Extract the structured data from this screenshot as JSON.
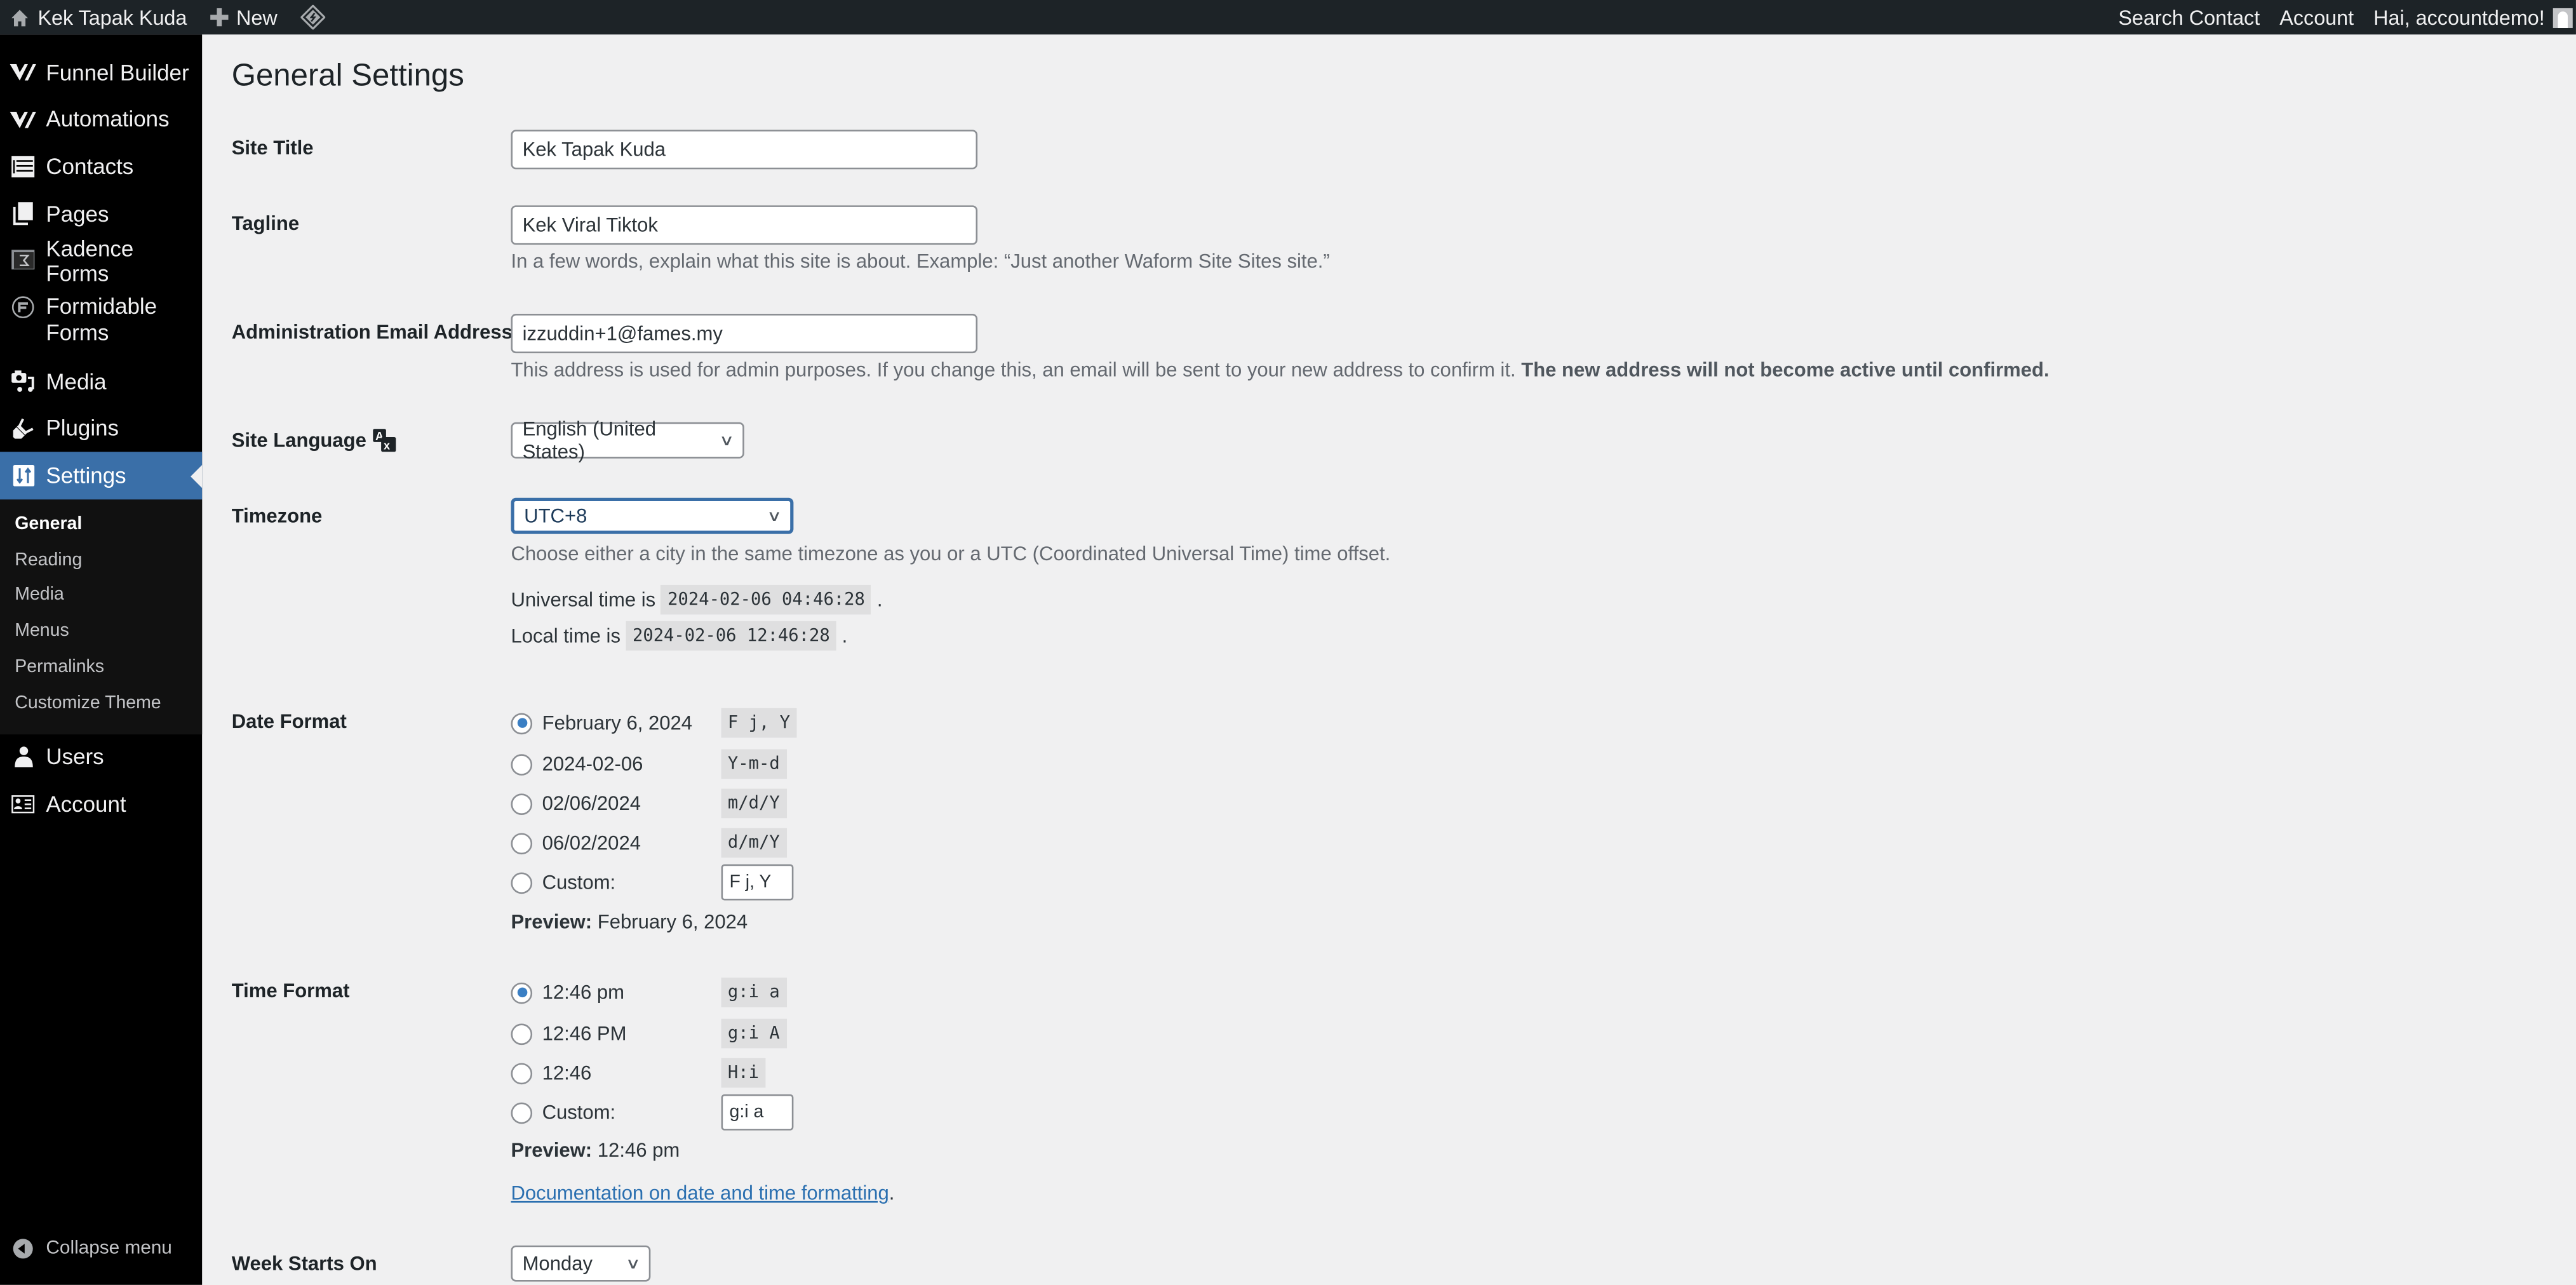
{
  "adminbar": {
    "site_name": "Kek Tapak Kuda",
    "new_label": "New",
    "search_contact": "Search Contact",
    "account": "Account",
    "greeting": "Hai, accountdemo!"
  },
  "sidebar": {
    "items": [
      {
        "label": "Funnel Builder",
        "icon": "funnel-builder-icon"
      },
      {
        "label": "Automations",
        "icon": "automations-icon"
      },
      {
        "label": "Contacts",
        "icon": "contacts-list-icon"
      },
      {
        "label": "Pages",
        "icon": "pages-icon"
      },
      {
        "label": "Kadence Forms",
        "icon": "kadence-forms-icon"
      },
      {
        "label": "Formidable Forms",
        "icon": "formidable-forms-icon"
      },
      {
        "label": "Media",
        "icon": "media-icon"
      },
      {
        "label": "Plugins",
        "icon": "plugins-icon"
      },
      {
        "label": "Settings",
        "icon": "settings-icon",
        "active": true
      }
    ],
    "submenu": [
      "General",
      "Reading",
      "Media",
      "Menus",
      "Permalinks",
      "Customize Theme"
    ],
    "items_after": [
      {
        "label": "Users",
        "icon": "users-icon"
      },
      {
        "label": "Account",
        "icon": "account-card-icon"
      }
    ],
    "collapse_label": "Collapse menu"
  },
  "page": {
    "title": "General Settings",
    "site_title": {
      "label": "Site Title",
      "value": "Kek Tapak Kuda"
    },
    "tagline": {
      "label": "Tagline",
      "value": "Kek Viral Tiktok",
      "description": "In a few words, explain what this site is about. Example: “Just another Waform Site Sites site.”"
    },
    "admin_email": {
      "label": "Administration Email Address",
      "value": "izzuddin+1@fames.my",
      "description": "This address is used for admin purposes. If you change this, an email will be sent to your new address to confirm it.",
      "description_bold": "The new address will not become active until confirmed."
    },
    "site_language": {
      "label": "Site Language",
      "value": "English (United States)"
    },
    "timezone": {
      "label": "Timezone",
      "value": "UTC+8",
      "description": "Choose either a city in the same timezone as you or a UTC (Coordinated Universal Time) time offset.",
      "universal_label": "Universal time is",
      "universal_value": "2024-02-06 04:46:28",
      "local_label": "Local time is",
      "local_value": "2024-02-06 12:46:28"
    },
    "date_format": {
      "label": "Date Format",
      "options": [
        {
          "text": "February 6, 2024",
          "code": "F j, Y",
          "checked": true
        },
        {
          "text": "2024-02-06",
          "code": "Y-m-d"
        },
        {
          "text": "02/06/2024",
          "code": "m/d/Y"
        },
        {
          "text": "06/02/2024",
          "code": "d/m/Y"
        }
      ],
      "custom_label": "Custom:",
      "custom_value": "F j, Y",
      "preview_label": "Preview:",
      "preview_value": "February 6, 2024"
    },
    "time_format": {
      "label": "Time Format",
      "options": [
        {
          "text": "12:46 pm",
          "code": "g:i a",
          "checked": true
        },
        {
          "text": "12:46 PM",
          "code": "g:i A"
        },
        {
          "text": "12:46",
          "code": "H:i"
        }
      ],
      "custom_label": "Custom:",
      "custom_value": "g:i a",
      "preview_label": "Preview:",
      "preview_value": "12:46 pm",
      "doc_link": "Documentation on date and time formatting"
    },
    "week_starts": {
      "label": "Week Starts On",
      "value": "Monday"
    }
  }
}
